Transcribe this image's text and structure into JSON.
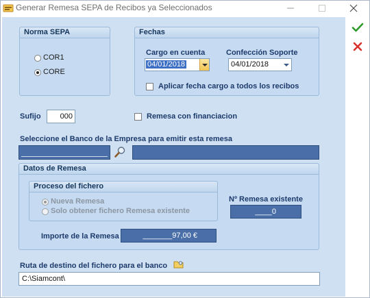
{
  "window": {
    "title": "Generar Remesa SEPA de Recibos ya Seleccionados"
  },
  "norma": {
    "title": "Norma SEPA",
    "options": [
      "COR1",
      "CORE"
    ],
    "selected": "CORE"
  },
  "fechas": {
    "title": "Fechas",
    "cargo_label": "Cargo en cuenta",
    "cargo_value": "04/01/2018",
    "confeccion_label": "Confección Soporte",
    "confeccion_value": "04/01/2018",
    "aplicar_label": "Aplicar fecha cargo a todos los recibos",
    "aplicar_checked": false
  },
  "sufijo": {
    "label": "Sufijo",
    "value": "000"
  },
  "financiacion": {
    "label": "Remesa con financiacion",
    "checked": false
  },
  "banco": {
    "label": "Seleccione el Banco de la Empresa para emitir esta remesa",
    "code": "",
    "name": ""
  },
  "datos": {
    "title": "Datos de Remesa",
    "proceso": {
      "title": "Proceso del fichero",
      "options": [
        "Nueva Remesa",
        "Solo obtener fichero Remesa existente"
      ],
      "selected": "Nueva Remesa"
    },
    "num_label": "Nº Remesa existente",
    "num_value": "____0",
    "importe_label": "Importe de la Remesa",
    "importe_value": "_______97,00 €"
  },
  "ruta": {
    "label": "Ruta de destino del fichero para el banco",
    "value": "C:\\Siamcont\\"
  },
  "icons": {
    "ok": "green-check-icon",
    "cancel": "red-x-icon",
    "search": "magnifier-icon",
    "folder": "folder-icon"
  },
  "colors": {
    "client": "#cfe0f2",
    "group": "#c6dbf1",
    "label": "#1c3a6b",
    "dark_field": "#4a6fa8"
  }
}
